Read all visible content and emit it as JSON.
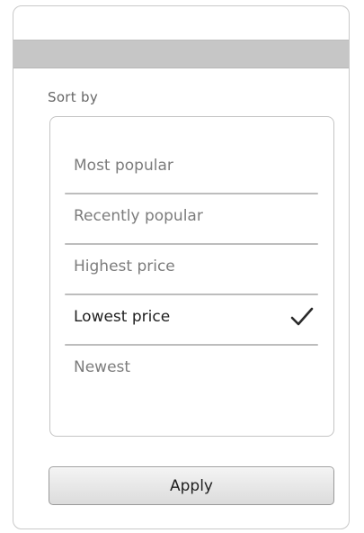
{
  "sort": {
    "label": "Sort by",
    "options": [
      {
        "label": "Most popular",
        "selected": false
      },
      {
        "label": "Recently popular",
        "selected": false
      },
      {
        "label": "Highest price",
        "selected": false
      },
      {
        "label": "Lowest price",
        "selected": true
      },
      {
        "label": "Newest",
        "selected": false
      }
    ],
    "selected_indicator_icon": "checkmark-icon"
  },
  "actions": {
    "apply_label": "Apply"
  },
  "colors": {
    "title_bar": "#c6c6c6",
    "selected_text": "#1f1f1f",
    "unselected_text": "#7c7c7c"
  }
}
